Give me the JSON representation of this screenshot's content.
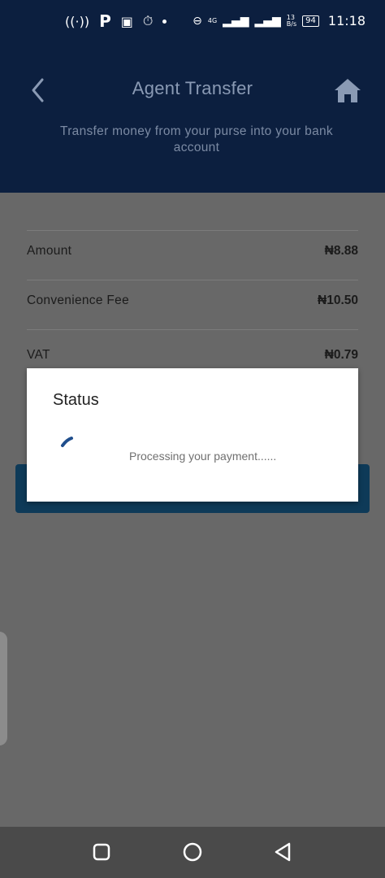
{
  "status_bar": {
    "time": "11:18",
    "battery": "94",
    "network": "4G",
    "speed_top": "13",
    "speed_bottom": "B/s",
    "left_letter": "P"
  },
  "header": {
    "title": "Agent Transfer",
    "subtitle": "Transfer money from your purse into your bank account"
  },
  "summary": {
    "rows": [
      {
        "label": "Amount",
        "value": "₦8.88"
      },
      {
        "label": "Convenience Fee",
        "value": "₦10.50"
      },
      {
        "label": "VAT",
        "value": "₦0.79"
      }
    ]
  },
  "dialog": {
    "title": "Status",
    "message": "Processing your payment......"
  },
  "colors": {
    "header_bg": "#0c1f3f",
    "overlay_bg": "#686868",
    "accent": "#1f4e8c",
    "dialog_bg": "#ffffff"
  },
  "icons": {
    "back": "chevron-left-icon",
    "home": "home-icon",
    "spinner": "spinner-icon",
    "nav_recents": "square-icon",
    "nav_home": "circle-icon",
    "nav_back": "triangle-back-icon"
  }
}
